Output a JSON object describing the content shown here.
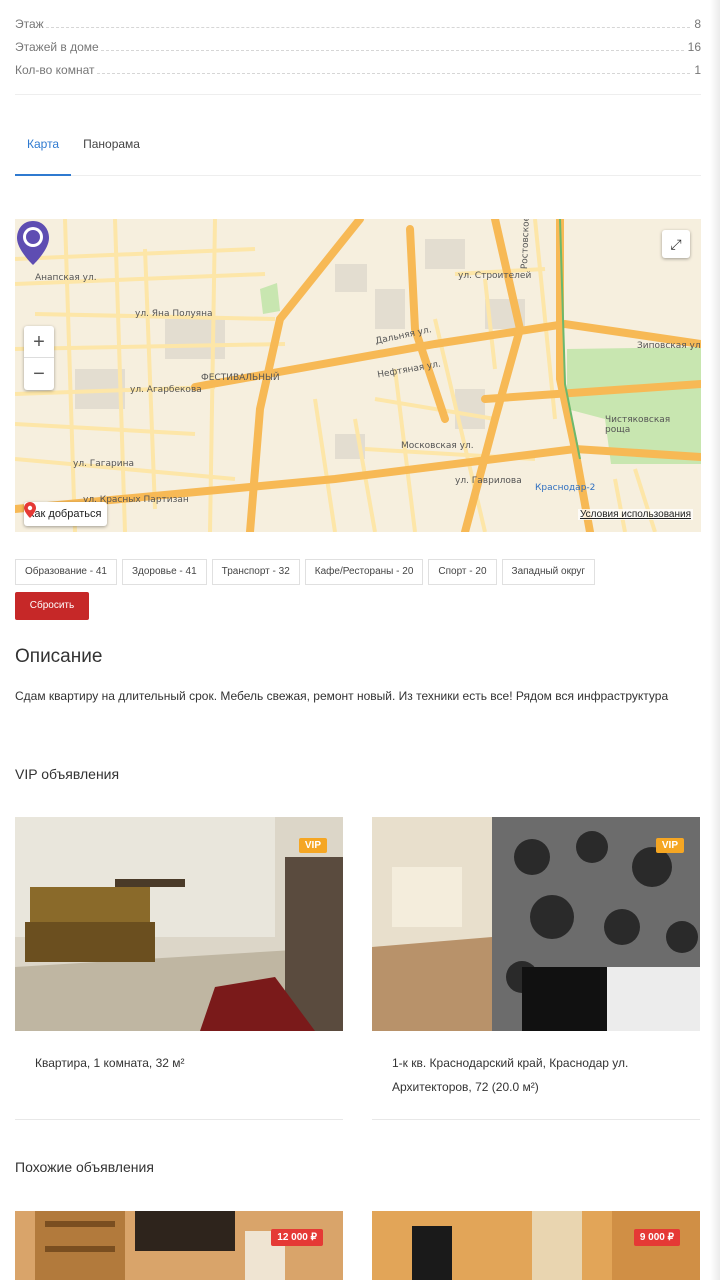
{
  "params": [
    {
      "label": "Этаж",
      "value": "8"
    },
    {
      "label": "Этажей в доме",
      "value": "16"
    },
    {
      "label": "Кол-во комнат",
      "value": "1"
    }
  ],
  "tabs": [
    {
      "label": "Карта",
      "active": true
    },
    {
      "label": "Панорама",
      "active": false
    }
  ],
  "map": {
    "route_label": "Как добраться",
    "terms_label": "Условия использования",
    "labels": [
      {
        "text": "ул. Яна Полуяна"
      },
      {
        "text": "ул. Агарбекова"
      },
      {
        "text": "ФЕСТИВАЛЬНЫЙ"
      },
      {
        "text": "Зиповская ул."
      },
      {
        "text": "Чистяковская роща"
      },
      {
        "text": "Краснодар-2"
      },
      {
        "text": "ул. Гаврилова"
      },
      {
        "text": "ул. Красных Партизан"
      },
      {
        "text": "Ростовское ш."
      },
      {
        "text": "ул. Строителей"
      },
      {
        "text": "Дальняя ул."
      },
      {
        "text": "Нефтяная ул."
      },
      {
        "text": "Московская ул."
      },
      {
        "text": "ул. Гагарина"
      },
      {
        "text": "Анапская ул."
      }
    ],
    "colors": {
      "road_major": "#f7b955",
      "road_minor": "#fde6a8",
      "park": "#c8e6b0",
      "bg": "#f6efde",
      "marker": "#5e4db2"
    }
  },
  "categories": [
    "Образование - 41",
    "Здоровье - 41",
    "Транспорт - 32",
    "Кафе/Рестораны - 20",
    "Спорт - 20",
    "Западный округ"
  ],
  "reset_label": "Сбросить",
  "description": {
    "title": "Описание",
    "text": "Сдам квартиру на длительный срок. Мебель свежая, ремонт новый. Из техники есть все! Рядом вся инфраструктура"
  },
  "vip": {
    "title": "VIP объявления",
    "items": [
      {
        "badge": "VIP",
        "caption": "Квартира, 1 комната, 32 м²"
      },
      {
        "badge": "VIP",
        "caption": "1-к кв. Краснодарский край, Краснодар ул. Архитекторов, 72 (20.0 м²)"
      }
    ]
  },
  "similar": {
    "title": "Похожие объявления",
    "items": [
      {
        "price": "12 000 ₽"
      },
      {
        "price": "9 000 ₽"
      }
    ]
  }
}
